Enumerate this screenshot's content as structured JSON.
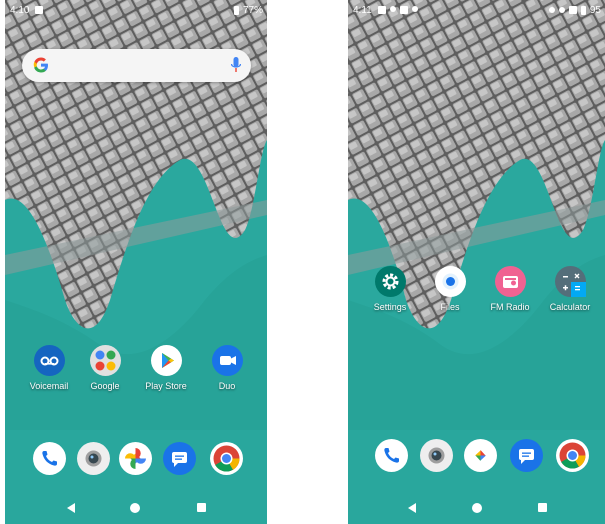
{
  "left_screen": {
    "status_bar": {
      "time": "4:10",
      "battery": "77%"
    },
    "search_bar": {
      "logo": "google-g-icon",
      "mic": "mic-icon"
    },
    "apps": [
      {
        "label": "Voicemail",
        "icon": "voicemail-icon",
        "color": "#1565c0"
      },
      {
        "label": "Google",
        "icon": "google-folder-icon",
        "color": "#e0e0e0"
      },
      {
        "label": "Play Store",
        "icon": "play-store-icon",
        "color": "#ffffff"
      },
      {
        "label": "Duo",
        "icon": "duo-icon",
        "color": "#1a73e8"
      }
    ],
    "dock": [
      {
        "icon": "phone-icon"
      },
      {
        "icon": "camera-icon"
      },
      {
        "icon": "photos-icon"
      },
      {
        "icon": "messages-icon"
      },
      {
        "icon": "chrome-icon"
      }
    ]
  },
  "right_screen": {
    "status_bar": {
      "time": "4:11",
      "battery": "95"
    },
    "apps": [
      {
        "label": "Settings",
        "icon": "settings-gear-icon",
        "color": "#00796b"
      },
      {
        "label": "Files",
        "icon": "files-icon",
        "color": "#ffffff"
      },
      {
        "label": "FM Radio",
        "icon": "fm-radio-icon",
        "color": "#f06292"
      },
      {
        "label": "Calculator",
        "icon": "calculator-icon",
        "color": "#546e7a"
      }
    ],
    "dock": [
      {
        "icon": "phone-icon"
      },
      {
        "icon": "camera-icon"
      },
      {
        "icon": "photos-icon"
      },
      {
        "icon": "messages-icon"
      },
      {
        "icon": "chrome-icon"
      }
    ]
  },
  "colors": {
    "teal": "#2aa89e",
    "teal_dark": "#1f8f86",
    "cobble": "#8c8c8c"
  }
}
